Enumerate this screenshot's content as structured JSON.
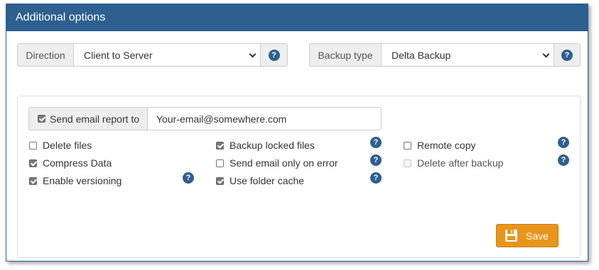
{
  "panel": {
    "title": "Additional options"
  },
  "direction": {
    "label": "Direction",
    "value": "Client to Server",
    "help": "?"
  },
  "backup_type": {
    "label": "Backup type",
    "value": "Delta Backup",
    "help": "?"
  },
  "email": {
    "label": "Send email report to",
    "value": "Your-email@somewhere.com",
    "checked": true
  },
  "options": {
    "delete_files": {
      "label": "Delete files",
      "checked": false
    },
    "compress_data": {
      "label": "Compress Data",
      "checked": true
    },
    "enable_versioning": {
      "label": "Enable versioning",
      "checked": true
    },
    "backup_locked_files": {
      "label": "Backup locked files",
      "checked": true
    },
    "send_email_only_on_error": {
      "label": "Send email only on error",
      "checked": false
    },
    "use_folder_cache": {
      "label": "Use folder cache",
      "checked": true
    },
    "remote_copy": {
      "label": "Remote copy",
      "checked": false
    },
    "delete_after_backup": {
      "label": "Delete after backup",
      "checked": false,
      "disabled": true
    }
  },
  "help_glyph": "?",
  "save": {
    "label": "Save",
    "icon": "floppy-disk-icon"
  },
  "colors": {
    "header": "#2d5f8f",
    "save_button": "#e8951b",
    "help": "#2d5f8f"
  }
}
